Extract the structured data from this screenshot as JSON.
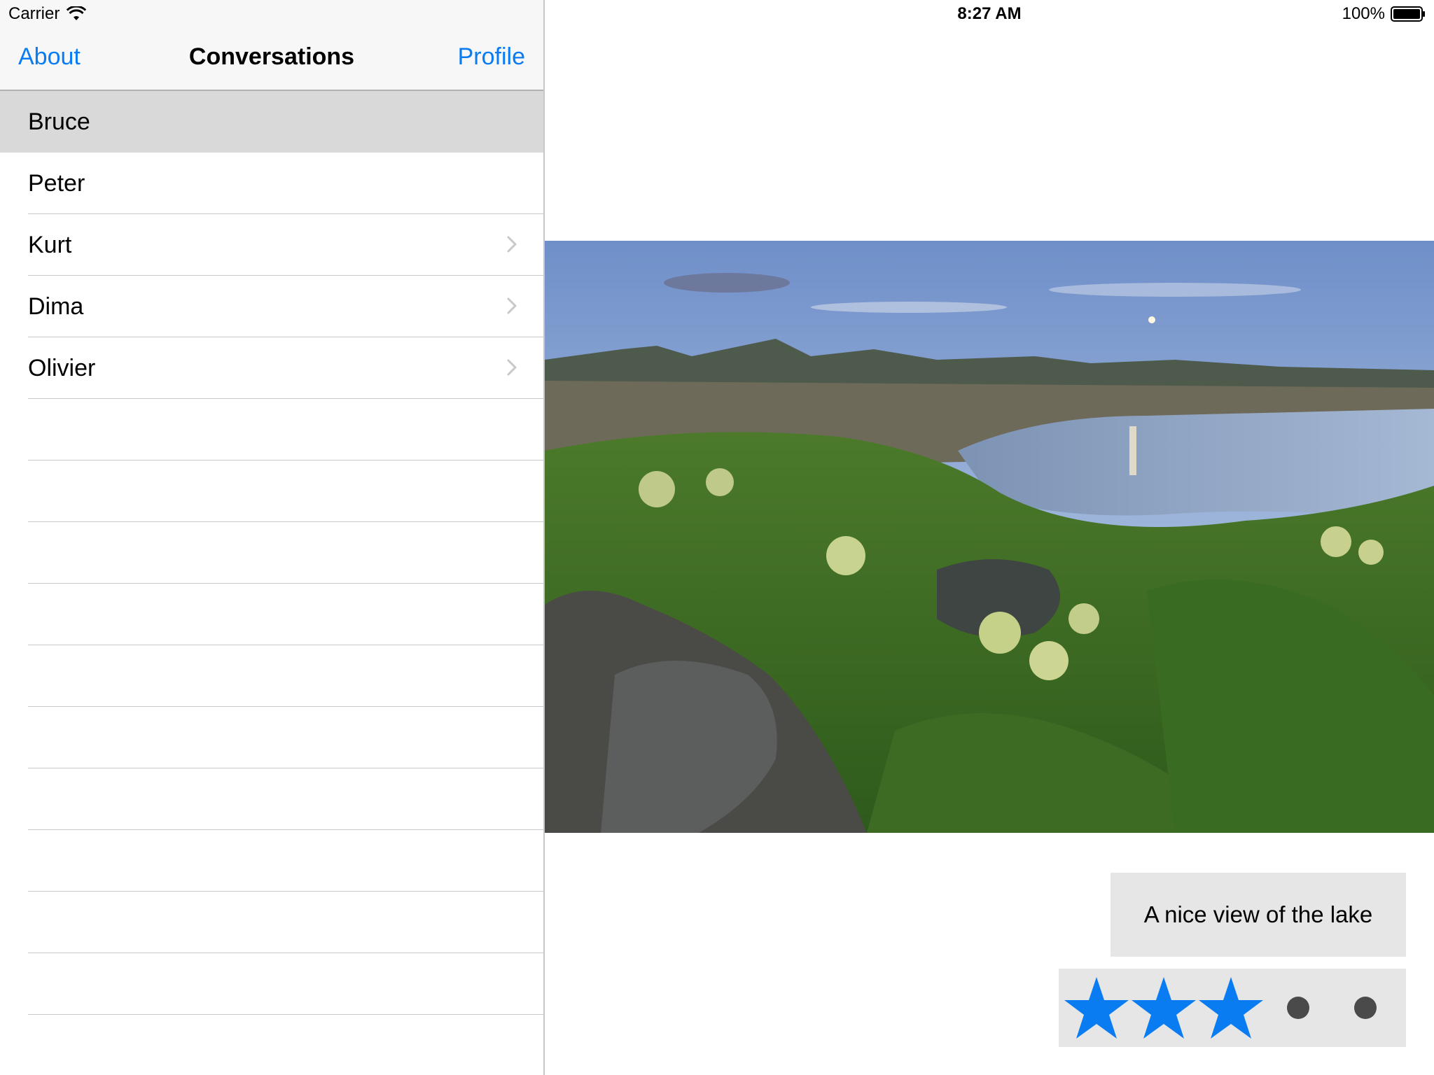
{
  "status_bar": {
    "carrier": "Carrier",
    "time": "8:27 AM",
    "battery": "100%"
  },
  "sidebar": {
    "nav": {
      "left_button": "About",
      "title": "Conversations",
      "right_button": "Profile"
    },
    "items": [
      {
        "label": "Bruce",
        "selected": true,
        "chevron": false
      },
      {
        "label": "Peter",
        "selected": false,
        "chevron": false
      },
      {
        "label": "Kurt",
        "selected": false,
        "chevron": true
      },
      {
        "label": "Dima",
        "selected": false,
        "chevron": true
      },
      {
        "label": "Olivier",
        "selected": false,
        "chevron": true
      }
    ]
  },
  "detail": {
    "caption": "A nice view of the lake",
    "rating": {
      "value": 3,
      "max": 5
    },
    "accent_color": "#0a7cf2"
  }
}
